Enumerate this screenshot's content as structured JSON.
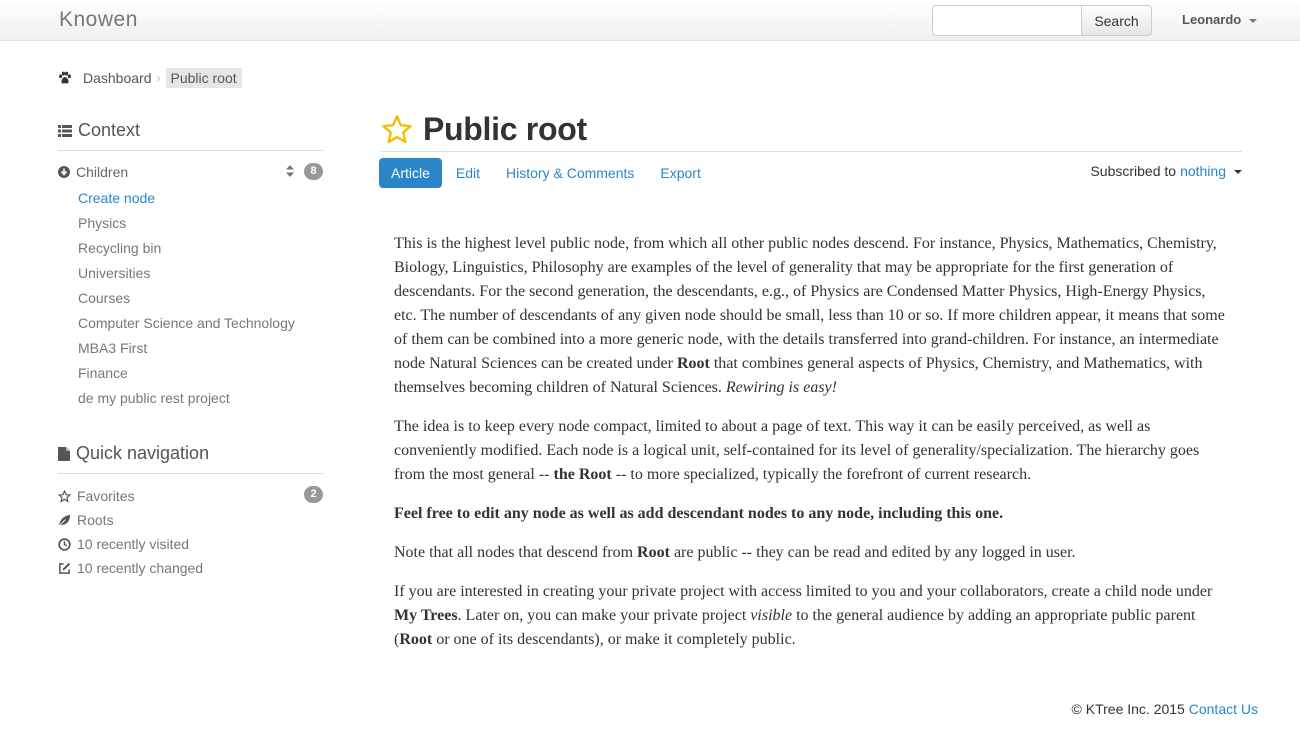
{
  "navbar": {
    "brand": "Knowen",
    "search_placeholder": "",
    "search_button": "Search",
    "user_name": "Leonardo"
  },
  "breadcrumb": {
    "items": [
      "Dashboard",
      "Public root"
    ]
  },
  "sidebar": {
    "context_heading": "Context",
    "children_label": "Children",
    "children_count": "8",
    "children": [
      "Create node",
      "Physics",
      "Recycling bin",
      "Universities",
      "Courses",
      "Computer Science and Technology",
      "MBA3 First",
      "Finance",
      "de my public rest project"
    ],
    "quick_nav_heading": "Quick navigation",
    "quick_nav": [
      {
        "label": "Favorites",
        "icon": "star-outline-icon",
        "badge": "2"
      },
      {
        "label": "Roots",
        "icon": "leaf-icon"
      },
      {
        "label": "10 recently visited",
        "icon": "clock-icon"
      },
      {
        "label": "10 recently changed",
        "icon": "edit-icon"
      }
    ]
  },
  "page": {
    "title": "Public root",
    "tabs": [
      "Article",
      "Edit",
      "History & Comments",
      "Export"
    ],
    "active_tab": "Article",
    "subscribed_prefix": "Subscribed to",
    "subscribed_value": "nothing"
  },
  "article": {
    "p1_a": "This is the highest level public node, from which all other public nodes descend. For instance, Physics, Mathematics, Chemistry, Biology, Linguistics, Philosophy are examples of the level of generality that may be appropriate for the first generation of descendants. For the second generation, the descendants, e.g., of Physics are Condensed Matter Physics, High-Energy Physics, etc. The number of descendants of any given node should be small, less than 10 or so. If more children appear, it means that some of them can be combined into a more generic node, with the details transferred into grand-children. For instance, an intermediate node Natural Sciences can be created under",
    "p1_bold": "Root",
    "p1_b": "that combines general aspects of Physics, Chemistry, and Mathematics, with themselves becoming children of Natural Sciences.",
    "p1_italic": "Rewiring is easy!",
    "p2_a": "The idea is to keep every node compact, limited to about a page of text. This way it can be easily perceived, as well as conveniently modified. Each node is a logical unit, self-contained for its level of generality/specialization. The hierarchy goes from the most general --",
    "p2_bold": "the Root",
    "p2_b": "-- to more specialized, typically the forefront of current research.",
    "p3_bold": "Feel free to edit any node as well as add descendant nodes to any node, including this one.",
    "p4_a": "Note that all nodes that descend from",
    "p4_bold": "Root",
    "p4_b": "are public -- they can be read and edited by any logged in user.",
    "p5_a": "If you are interested in creating your private project with access limited to you and your collaborators, create a child node under",
    "p5_bold1": "My Trees",
    "p5_b": ". Later on, you can make your private project",
    "p5_italic": "visible",
    "p5_c": "to the general audience by adding an appropriate public parent (",
    "p5_bold2": "Root",
    "p5_d": "or one of its descendants), or make it completely public."
  },
  "footer": {
    "copyright": "© KTree Inc. 2015",
    "contact": "Contact Us"
  },
  "colors": {
    "accent": "#2a86c8",
    "star": "#f0c000",
    "badge": "#999999"
  }
}
